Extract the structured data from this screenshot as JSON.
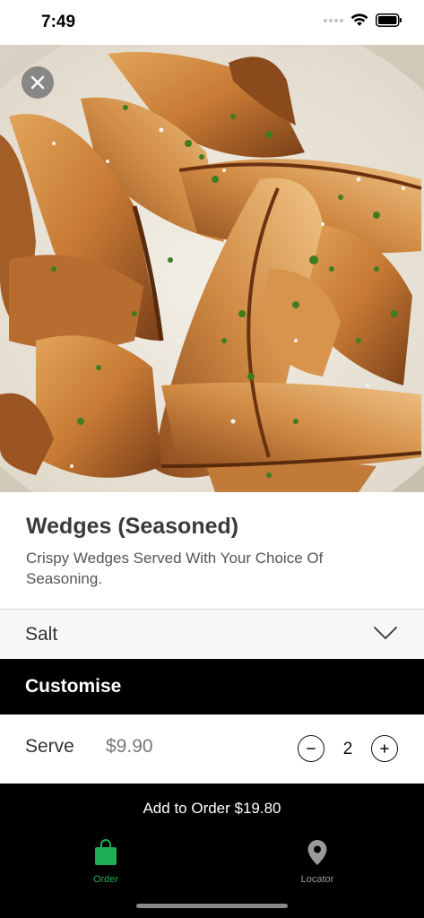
{
  "status_bar": {
    "time": "7:49"
  },
  "hero": {
    "image": "seasoned potato wedges in a bowl"
  },
  "product": {
    "title": "Wedges (Seasoned)",
    "description": "Crispy Wedges Served With Your Choice Of Seasoning."
  },
  "seasoning_select": {
    "value": "Salt"
  },
  "customise": {
    "label": "Customise"
  },
  "serve": {
    "label": "Serve",
    "price": "$9.90",
    "quantity": "2"
  },
  "add_to_order": {
    "label": "Add to Order $19.80"
  },
  "tab_bar": {
    "items": [
      {
        "label": "Order",
        "icon": "shopping-bag-icon",
        "active": true
      },
      {
        "label": "Locator",
        "icon": "map-pin-icon",
        "active": false
      }
    ]
  },
  "colors": {
    "accent": "#1fae54",
    "dark": "#000000"
  }
}
